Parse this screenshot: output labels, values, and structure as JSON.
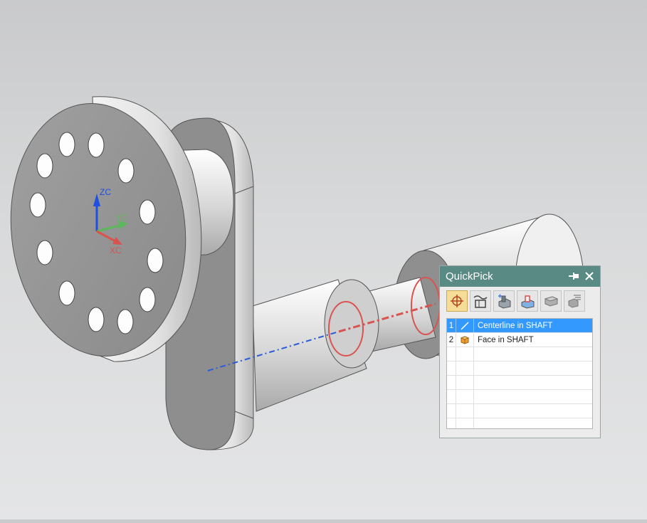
{
  "triad": {
    "zc": "ZC",
    "yc": "YC",
    "xc": "XC"
  },
  "quickpick": {
    "title": "QuickPick",
    "pin_icon": "pin-icon",
    "close_icon": "close-icon",
    "toolbar": [
      {
        "name": "all-objects-filter",
        "icon": "crosshair-icon",
        "active": true
      },
      {
        "name": "curves-filter",
        "icon": "curves-icon",
        "active": false
      },
      {
        "name": "features-filter",
        "icon": "feature-icon",
        "active": false
      },
      {
        "name": "bodies-filter",
        "icon": "body-icon",
        "active": false
      },
      {
        "name": "components-filter",
        "icon": "component-icon",
        "active": false
      },
      {
        "name": "other-filter",
        "icon": "other-icon",
        "active": false
      }
    ],
    "items": [
      {
        "index": "1",
        "icon": "centerline-icon",
        "label": "Centerline in SHAFT",
        "selected": true
      },
      {
        "index": "2",
        "icon": "face-icon",
        "label": "Face in SHAFT",
        "selected": false
      }
    ],
    "empty_rows": 6
  },
  "colors": {
    "title_bar": "#5a8a84",
    "selection": "#3399ff",
    "highlight_red": "#d9534f",
    "centerline_blue": "#2a5bd7"
  }
}
